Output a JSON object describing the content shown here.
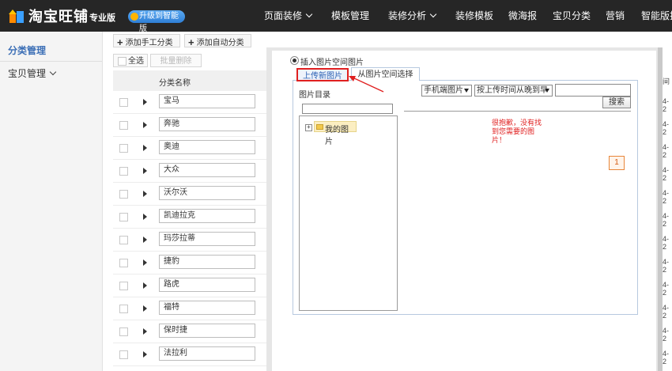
{
  "header": {
    "logo_text": "淘宝旺铺",
    "edition": "专业版",
    "upgrade_label": "升级到智能版",
    "nav": [
      {
        "label": "页面装修",
        "dropdown": true
      },
      {
        "label": "模板管理",
        "dropdown": false
      },
      {
        "label": "装修分析",
        "dropdown": true
      },
      {
        "label": "装修模板",
        "dropdown": false
      },
      {
        "label": "微海报",
        "dropdown": false
      },
      {
        "label": "宝贝分类",
        "dropdown": false
      },
      {
        "label": "营销",
        "dropdown": false
      },
      {
        "label": "智能版拾",
        "dropdown": false
      }
    ]
  },
  "sidebar": {
    "items": [
      {
        "label": "分类管理",
        "active": true
      },
      {
        "label": "宝贝管理",
        "active": false
      }
    ]
  },
  "toolbar": {
    "add_manual": "添加手工分类",
    "add_auto": "添加自动分类"
  },
  "list": {
    "select_all": "全选",
    "batch_delete": "批量删除",
    "column_name": "分类名称",
    "rows": [
      "宝马",
      "奔驰",
      "奥迪",
      "大众",
      "沃尔沃",
      "凯迪拉克",
      "玛莎拉蒂",
      "捷豹",
      "路虎",
      "福特",
      "保时捷",
      "法拉利"
    ]
  },
  "dialog": {
    "insert_label": "插入图片空间图片",
    "tab_upload": "上传新图片",
    "tab_choose": "从图片空间选择",
    "dir_label": "图片目录",
    "tree_item": "我的图片",
    "select_device": "手机端图片",
    "select_sort": "按上传时间从晚到早",
    "search_button": "搜索",
    "empty_message": "很抱歉，没有找到您需要的图片！",
    "page_number": "1"
  },
  "edge": {
    "col_fragment": "间",
    "date_fragments": [
      "4-2",
      "4-2",
      "4-2",
      "4-2",
      "4-2",
      "4-2",
      "4-2",
      "4-2",
      "4-2",
      "4-2",
      "4-2",
      "4-2"
    ]
  },
  "colors": {
    "topbar": "#262626",
    "accent_blue": "#3c6fb6",
    "annotation_red": "#e02020",
    "page_badge": "#e8863a"
  }
}
